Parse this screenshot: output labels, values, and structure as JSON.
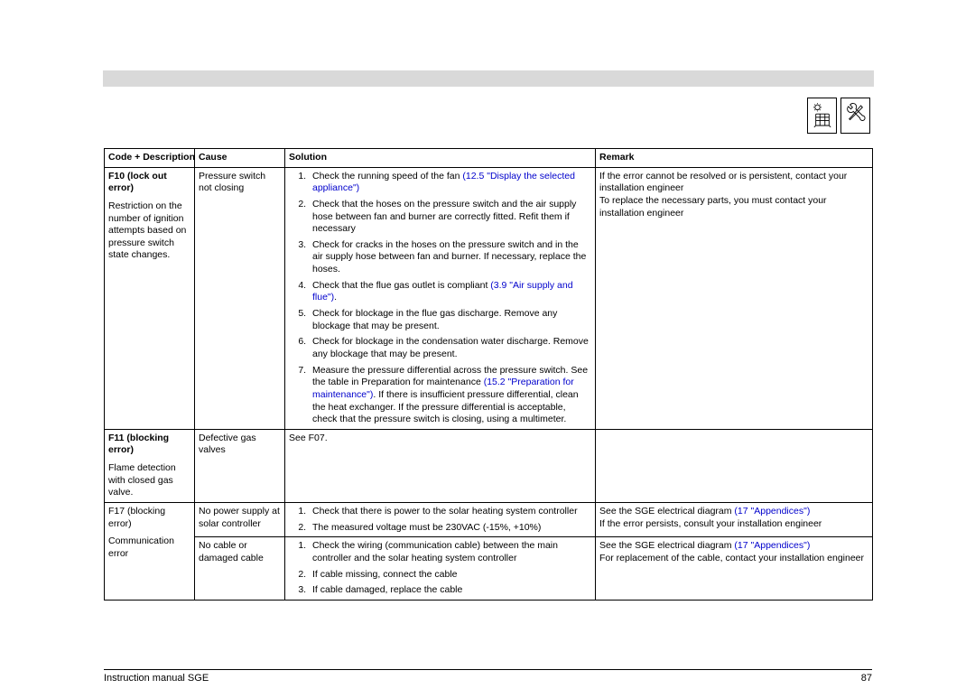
{
  "headers": {
    "code": "Code + Description",
    "cause": "Cause",
    "solution": "Solution",
    "remark": "Remark"
  },
  "rows": [
    {
      "code_bold": "F10 (lock out error)",
      "code_sub": "Restriction on the number of ignition attempts based on pressure switch state changes.",
      "cause": "Pressure switch not closing",
      "solution_items": [
        {
          "pre": "Check the running speed of the fan ",
          "link": "(12.5 \"Display the selected appliance\")",
          "post": ""
        },
        {
          "pre": "Check that the hoses on the pressure switch and the air supply hose between fan and burner are correctly fitted. Refit them if necessary",
          "link": "",
          "post": ""
        },
        {
          "pre": "Check for cracks in the hoses on the pressure switch and in the air supply hose between fan and burner. If necessary, replace the hoses.",
          "link": "",
          "post": ""
        },
        {
          "pre": "Check that the flue gas outlet is compliant ",
          "link": "(3.9 \"Air supply and flue\")",
          "post": "."
        },
        {
          "pre": "Check for blockage in the flue gas discharge. Remove any blockage that may be present.",
          "link": "",
          "post": ""
        },
        {
          "pre": "Check for blockage in the condensation water discharge. Remove any blockage that may be present.",
          "link": "",
          "post": ""
        },
        {
          "pre": "Measure the pressure differential across the pressure switch. See the table in Preparation for maintenance ",
          "link": "(15.2 \"Preparation for maintenance\")",
          "post": ". If there is insufficient pressure differential, clean the heat exchanger. If the pressure differential is acceptable, check that the pressure switch is closing, using a multimeter."
        }
      ],
      "remark": "If the error cannot be resolved or is persistent, contact your installation engineer\nTo replace the necessary parts, you must contact your installation engineer"
    },
    {
      "code_bold": "F11 (blocking error)",
      "code_sub": "Flame detection with closed gas valve.",
      "cause": "Defective gas valves",
      "solution_plain": "See F07.",
      "remark": ""
    },
    {
      "code_plain": "F17 (blocking error)",
      "code_sub": "Communication error",
      "cause": "No power supply at solar controller",
      "solution_items": [
        {
          "pre": "Check that there is power to the solar heating system controller",
          "link": "",
          "post": ""
        },
        {
          "pre": "The measured voltage must be 230VAC (-15%, +10%)",
          "link": "",
          "post": ""
        }
      ],
      "remark_pre": "See the SGE electrical diagram ",
      "remark_link": "(17 \"Appendices\")",
      "remark_post": "\nIf the error persists, consult your installation engineer"
    },
    {
      "cause": "No cable or damaged cable",
      "solution_items": [
        {
          "pre": "Check the wiring (communication cable) between the main controller and the solar heating system controller",
          "link": "",
          "post": ""
        },
        {
          "pre": "If cable missing, connect the cable",
          "link": "",
          "post": ""
        },
        {
          "pre": "If cable damaged, replace the cable",
          "link": "",
          "post": ""
        }
      ],
      "remark_pre": "See the SGE electrical diagram ",
      "remark_link": "(17 \"Appendices\")",
      "remark_post": "\nFor replacement of the cable, contact your installation engineer"
    }
  ],
  "footer": {
    "left": "Instruction manual SGE",
    "right": "87"
  }
}
